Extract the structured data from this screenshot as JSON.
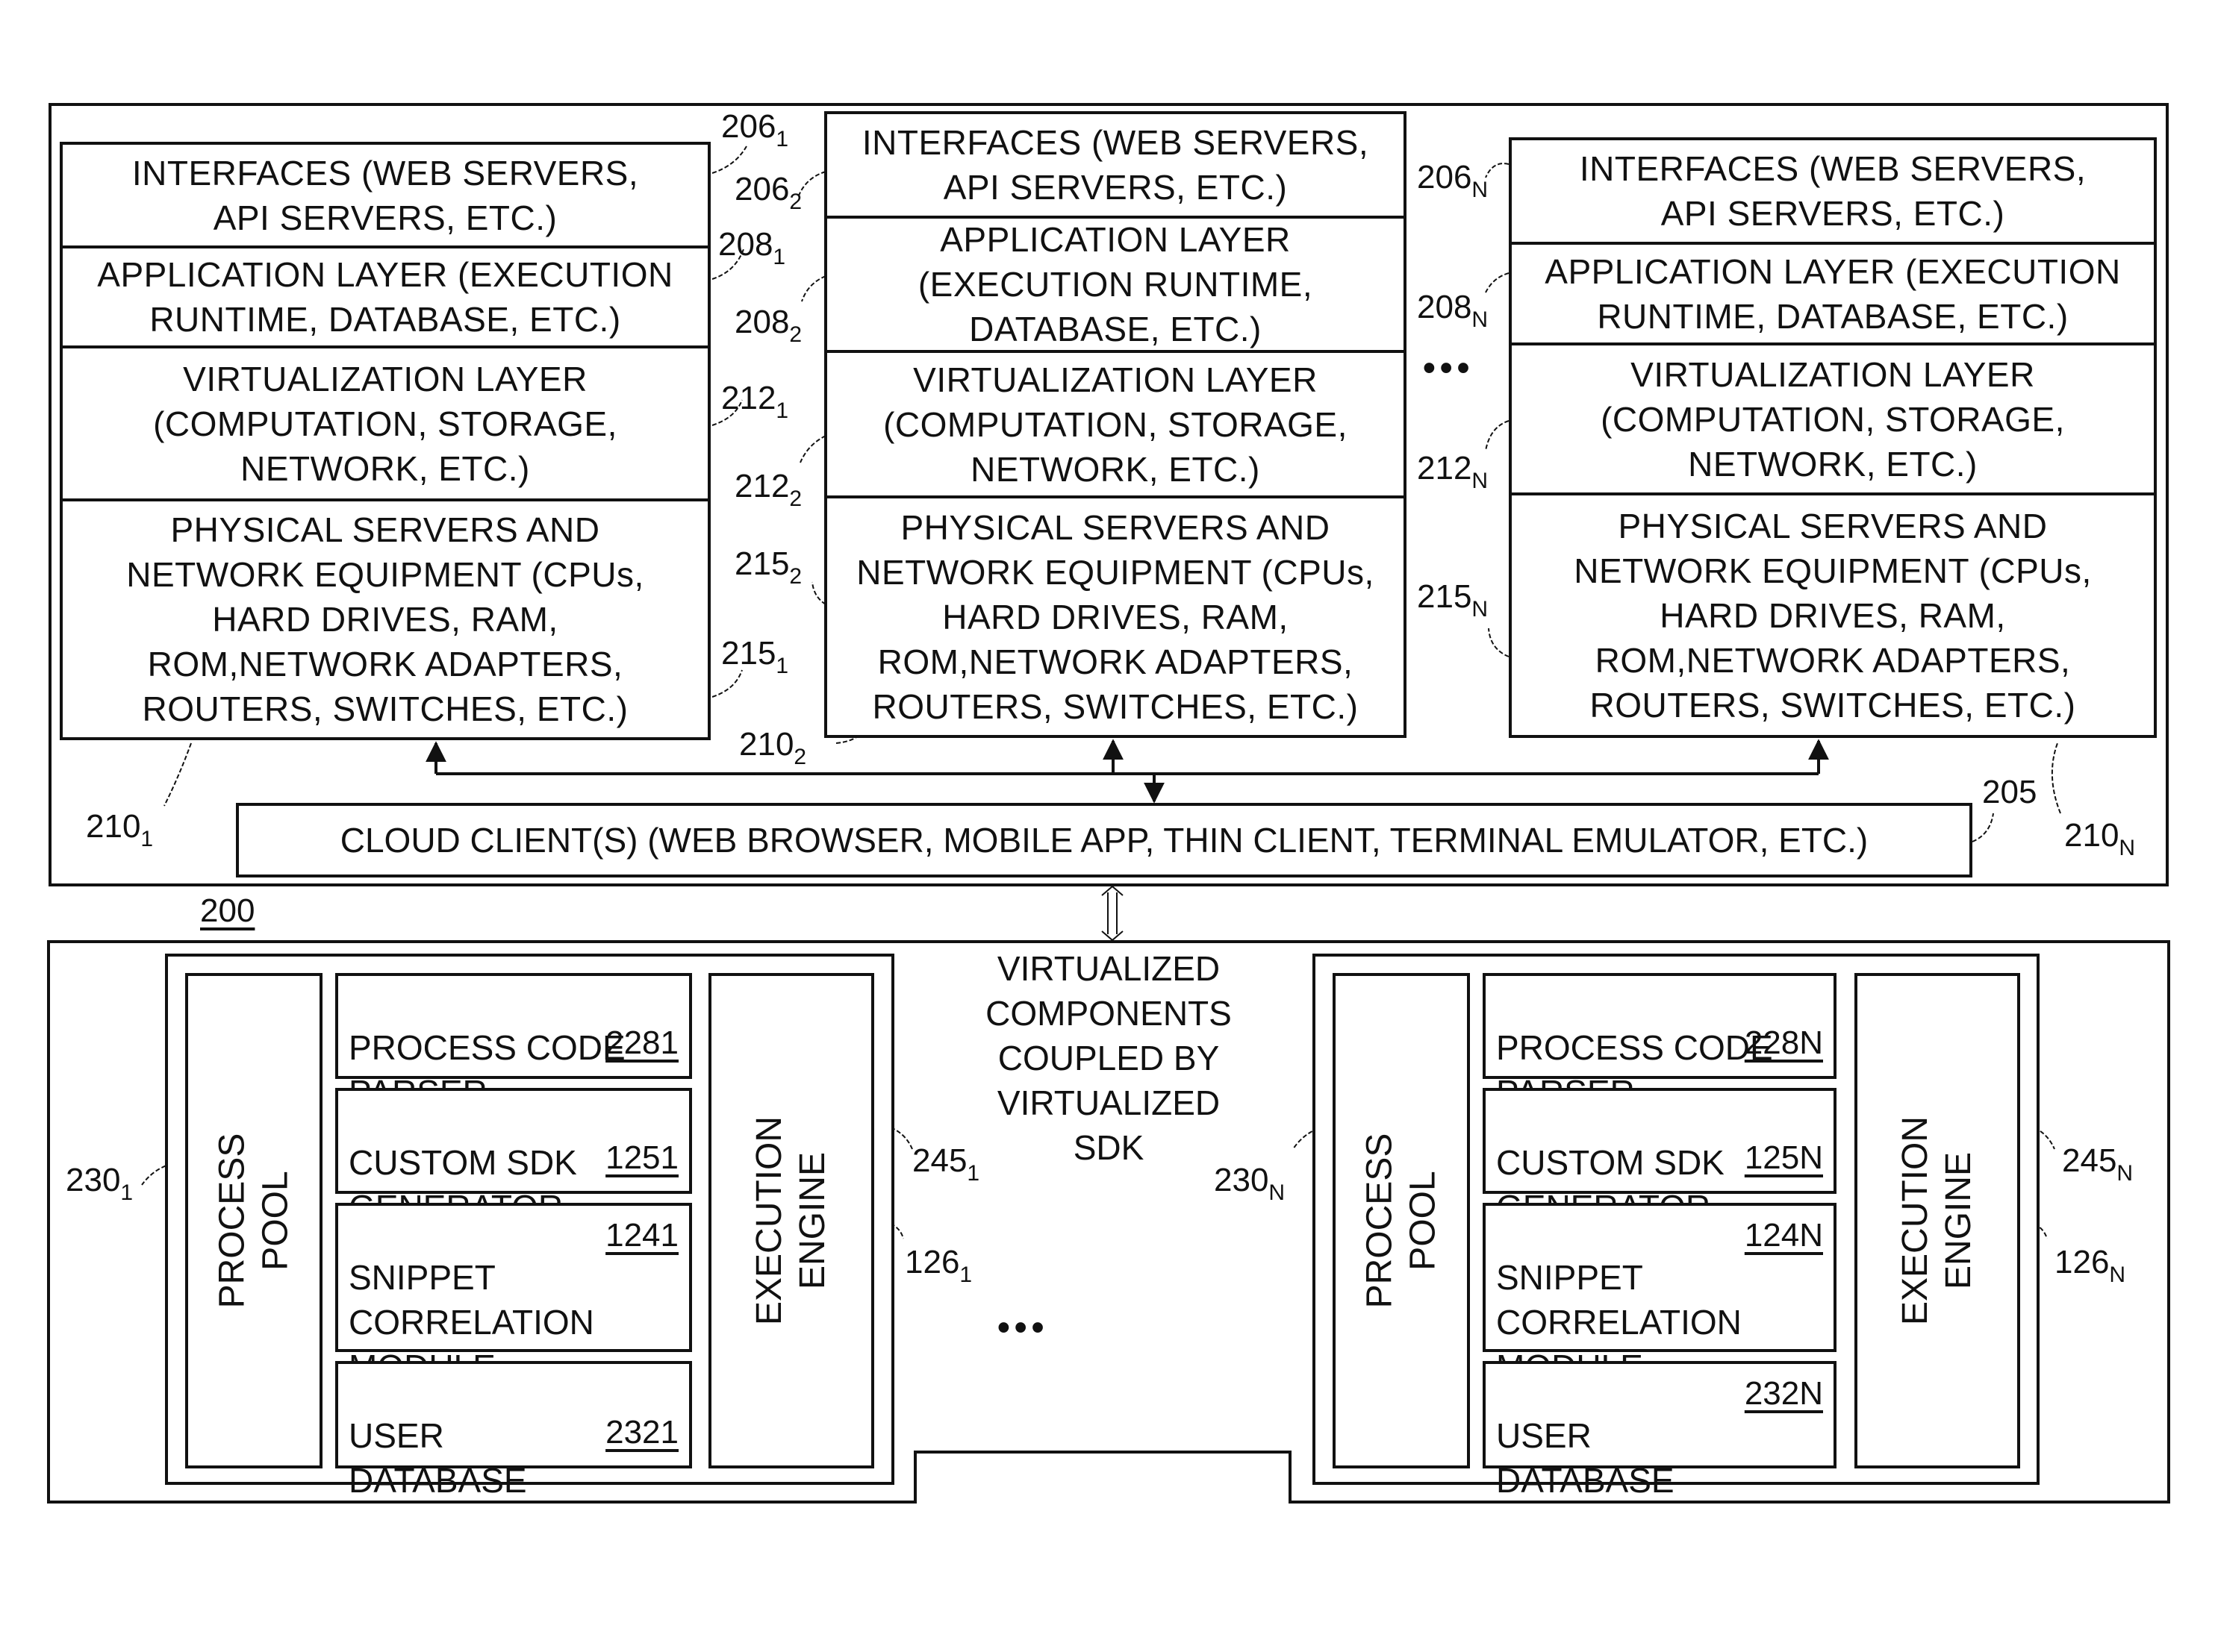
{
  "figure_ref": "200",
  "cloud_stacks": [
    {
      "id": "stack-1",
      "ref": {
        "base": "210",
        "sub": "1"
      },
      "layers": [
        {
          "name": "interfaces",
          "text": "INTERFACES (WEB SERVERS,\nAPI SERVERS, ETC.)",
          "ref": {
            "base": "206",
            "sub": "1"
          }
        },
        {
          "name": "application",
          "text": "APPLICATION LAYER (EXECUTION\nRUNTIME, DATABASE, ETC.)",
          "ref": {
            "base": "208",
            "sub": "1"
          }
        },
        {
          "name": "virtualization",
          "text": "VIRTUALIZATION LAYER\n(COMPUTATION, STORAGE,\nNETWORK, ETC.)",
          "ref": {
            "base": "212",
            "sub": "1"
          }
        },
        {
          "name": "physical",
          "text": "PHYSICAL SERVERS AND\nNETWORK EQUIPMENT (CPUs,\nHARD DRIVES, RAM,\nROM,NETWORK ADAPTERS,\nROUTERS, SWITCHES, ETC.)",
          "ref": {
            "base": "215",
            "sub": "1"
          }
        }
      ]
    },
    {
      "id": "stack-2",
      "ref": {
        "base": "210",
        "sub": "2"
      },
      "layers": [
        {
          "name": "interfaces",
          "text": "INTERFACES (WEB SERVERS,\nAPI SERVERS, ETC.)",
          "ref": {
            "base": "206",
            "sub": "2"
          }
        },
        {
          "name": "application",
          "text": "APPLICATION LAYER\n(EXECUTION RUNTIME,\nDATABASE, ETC.)",
          "ref": {
            "base": "208",
            "sub": "2"
          }
        },
        {
          "name": "virtualization",
          "text": "VIRTUALIZATION LAYER\n(COMPUTATION, STORAGE,\nNETWORK, ETC.)",
          "ref": {
            "base": "212",
            "sub": "2"
          }
        },
        {
          "name": "physical",
          "text": "PHYSICAL SERVERS AND\nNETWORK EQUIPMENT (CPUs,\nHARD DRIVES, RAM,\nROM,NETWORK ADAPTERS,\nROUTERS, SWITCHES, ETC.)",
          "ref": {
            "base": "215",
            "sub": "2"
          }
        }
      ]
    },
    {
      "id": "stack-n",
      "ref": {
        "base": "210",
        "sub": "N"
      },
      "layers": [
        {
          "name": "interfaces",
          "text": "INTERFACES (WEB SERVERS,\nAPI SERVERS, ETC.)",
          "ref": {
            "base": "206",
            "sub": "N"
          }
        },
        {
          "name": "application",
          "text": "APPLICATION LAYER (EXECUTION\nRUNTIME, DATABASE, ETC.)",
          "ref": {
            "base": "208",
            "sub": "N"
          }
        },
        {
          "name": "virtualization",
          "text": "VIRTUALIZATION LAYER\n(COMPUTATION, STORAGE,\nNETWORK, ETC.)",
          "ref": {
            "base": "212",
            "sub": "N"
          }
        },
        {
          "name": "physical",
          "text": "PHYSICAL SERVERS AND\nNETWORK EQUIPMENT (CPUs,\nHARD DRIVES, RAM,\nROM,NETWORK ADAPTERS,\nROUTERS, SWITCHES, ETC.)",
          "ref": {
            "base": "215",
            "sub": "N"
          }
        }
      ]
    }
  ],
  "ellipsis": "•••",
  "cloud_client": {
    "text": "CLOUD CLIENT(S) (WEB BROWSER, MOBILE APP, THIN CLIENT, TERMINAL EMULATOR, ETC.)",
    "ref": "205"
  },
  "virtualized_label": "VIRTUALIZED\nCOMPONENTS\nCOUPLED BY\nVIRTUALIZED\nSDK",
  "virtual_components": [
    {
      "id": "vc-1",
      "process_pool": {
        "text": "PROCESS\nPOOL",
        "ref": {
          "base": "230",
          "sub": "1"
        }
      },
      "execution_engine": {
        "text": "EXECUTION\nENGINE",
        "ref": {
          "base": "245",
          "sub": "1"
        },
        "ref2": {
          "base": "126",
          "sub": "1"
        }
      },
      "modules": [
        {
          "name": "process-code-parser",
          "text": "PROCESS CODE\nPARSER",
          "ref": "2281"
        },
        {
          "name": "custom-sdk-generator",
          "text": "CUSTOM SDK\nGENERATOR",
          "ref": "1251"
        },
        {
          "name": "snippet-correlation-module",
          "text": "SNIPPET\nCORRELATION\nMODULE",
          "ref": "1241"
        },
        {
          "name": "user-database",
          "text": "USER\nDATABASE",
          "ref": "2321"
        }
      ]
    },
    {
      "id": "vc-n",
      "process_pool": {
        "text": "PROCESS\nPOOL",
        "ref": {
          "base": "230",
          "sub": "N"
        }
      },
      "execution_engine": {
        "text": "EXECUTION\nENGINE",
        "ref": {
          "base": "245",
          "sub": "N"
        },
        "ref2": {
          "base": "126",
          "sub": "N"
        }
      },
      "modules": [
        {
          "name": "process-code-parser",
          "text": "PROCESS CODE\nPARSER",
          "ref": "228N"
        },
        {
          "name": "custom-sdk-generator",
          "text": "CUSTOM SDK\nGENERATOR",
          "ref": "125N"
        },
        {
          "name": "snippet-correlation-module",
          "text": "SNIPPET\nCORRELATION\nMODULE",
          "ref": "124N"
        },
        {
          "name": "user-database",
          "text": "USER\nDATABASE",
          "ref": "232N"
        }
      ]
    }
  ]
}
